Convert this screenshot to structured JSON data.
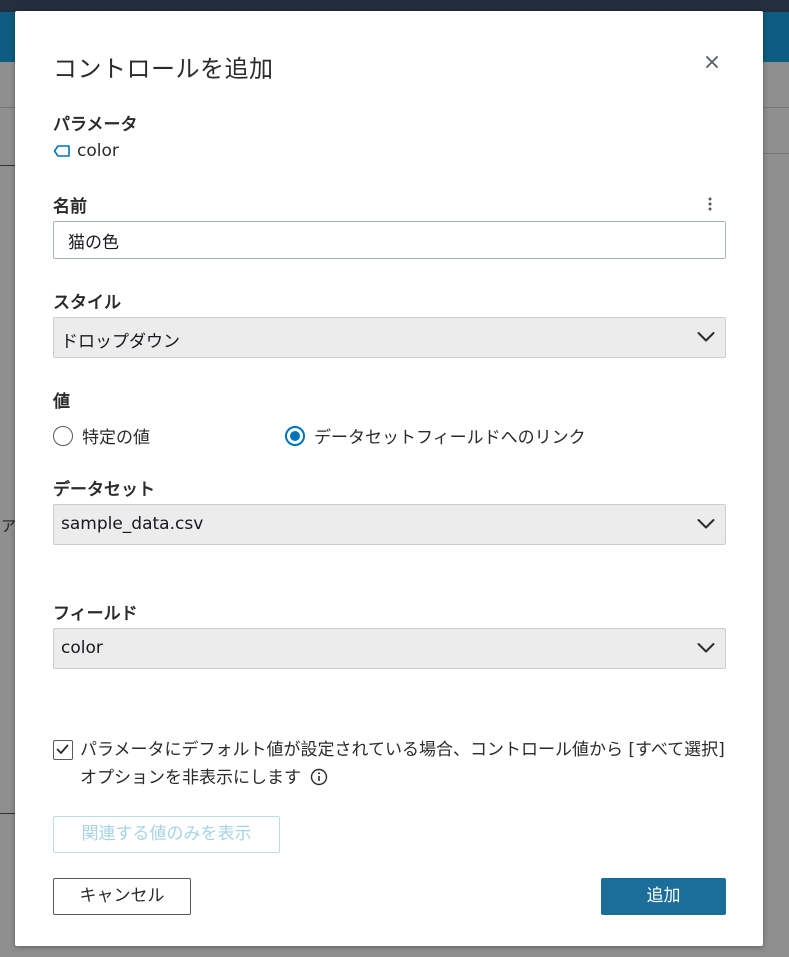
{
  "modal": {
    "title": "コントロールを追加",
    "parameter": {
      "label": "パラメータ",
      "value": "color"
    },
    "name": {
      "label": "名前",
      "value": "猫の色"
    },
    "style": {
      "label": "スタイル",
      "selected": "ドロップダウン"
    },
    "values": {
      "label": "値",
      "options": [
        {
          "label": "特定の値",
          "checked": false
        },
        {
          "label": "データセットフィールドへのリンク",
          "checked": true
        }
      ]
    },
    "dataset": {
      "label": "データセット",
      "selected": "sample_data.csv"
    },
    "field": {
      "label": "フィールド",
      "selected": "color"
    },
    "hide_select_all": {
      "checked": true,
      "text": "パラメータにデフォルト値が設定されている場合、コントロール値から [すべて選択] オプションを非表示にします"
    },
    "relevant_values_button": "関連する値のみを表示",
    "cancel_button": "キャンセル",
    "add_button": "追加"
  },
  "background": {
    "edge_text": "ア"
  },
  "colors": {
    "primary": "#1b6d9a",
    "radio_accent": "#0073bb",
    "header_bar": "#0d5d82"
  },
  "icons": [
    "close-icon",
    "tag-icon",
    "more-vertical-icon",
    "chevron-down-icon",
    "checkmark-icon",
    "info-icon"
  ]
}
